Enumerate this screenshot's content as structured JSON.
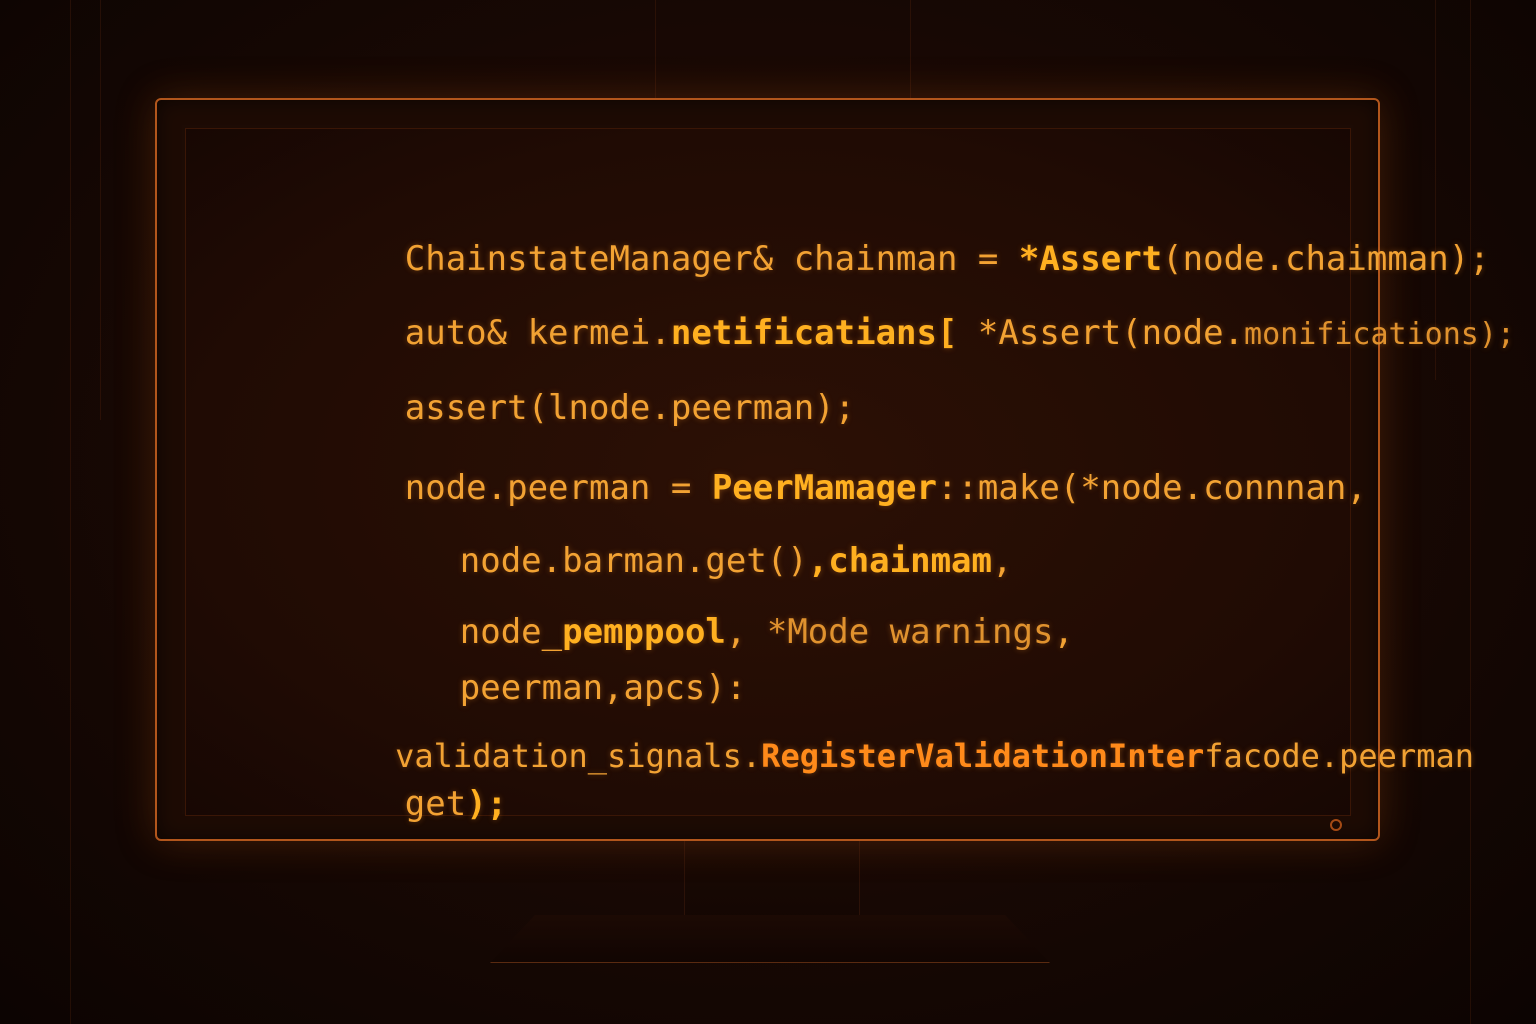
{
  "code": {
    "line1": [
      "ChainstateManager& chainman = ",
      "*Assert",
      "(node.chaimman);"
    ],
    "line2": [
      "auto& kermei.",
      "netificatians[",
      " *Assert(node.",
      "monifications);"
    ],
    "line3": [
      "assert(lnode.peerman);"
    ],
    "line4": [
      "node.peerman = ",
      "PeerMamager",
      "::make(*node.connnan,"
    ],
    "line5": [
      "node.barman.get()",
      ",chainmam",
      ","
    ],
    "line6": [
      "node_",
      "pemppool",
      ", ",
      "*Mode warnings",
      ","
    ],
    "line7": [
      "peerman,apcs):"
    ],
    "line8": [
      "validation_signals.",
      "RegisterValidationInter",
      "facode.peerman"
    ],
    "line9": [
      "get",
      ");"
    ]
  },
  "colors": {
    "code_text": "#f2a233",
    "code_bold": "#ffb020",
    "code_hot": "#ff8a1a",
    "bezel": "#b2561c",
    "background": "#1a0904"
  }
}
